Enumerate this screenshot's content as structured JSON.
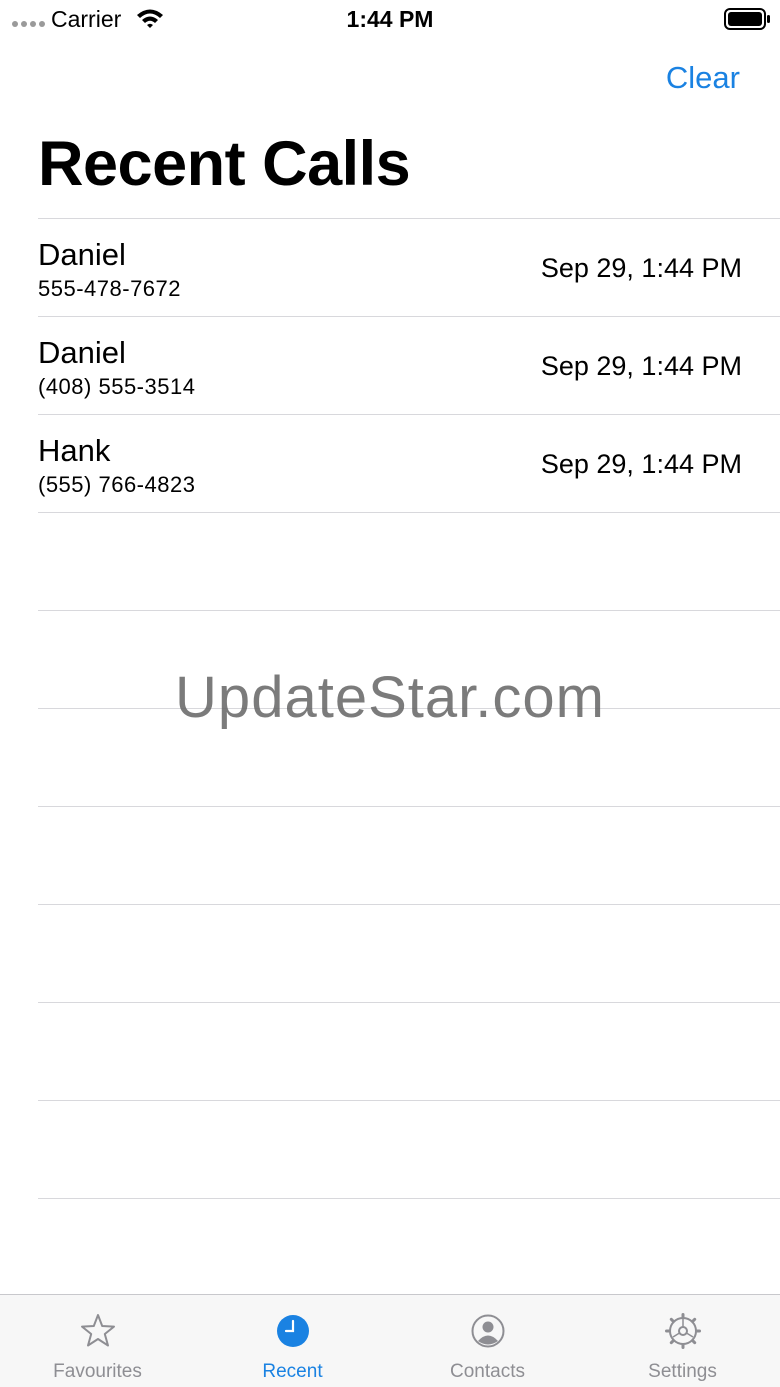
{
  "status_bar": {
    "carrier": "Carrier",
    "time": "1:44 PM"
  },
  "nav": {
    "clear_label": "Clear",
    "title": "Recent Calls"
  },
  "calls": [
    {
      "name": "Daniel",
      "number": "555-478-7672",
      "date": "Sep 29, 1:44 PM"
    },
    {
      "name": "Daniel",
      "number": "(408) 555-3514",
      "date": "Sep 29, 1:44 PM"
    },
    {
      "name": "Hank",
      "number": "(555) 766-4823",
      "date": "Sep 29, 1:44 PM"
    }
  ],
  "watermark": "UpdateStar.com",
  "tab_bar": {
    "tabs": [
      {
        "label": "Favourites",
        "icon": "star-icon",
        "active": false
      },
      {
        "label": "Recent",
        "icon": "clock-icon",
        "active": true
      },
      {
        "label": "Contacts",
        "icon": "person-circle-icon",
        "active": false
      },
      {
        "label": "Settings",
        "icon": "gear-icon",
        "active": false
      }
    ]
  },
  "colors": {
    "accent": "#1a82e2",
    "inactive_tab": "#8e8e93",
    "separator": "#d8d8dc"
  }
}
